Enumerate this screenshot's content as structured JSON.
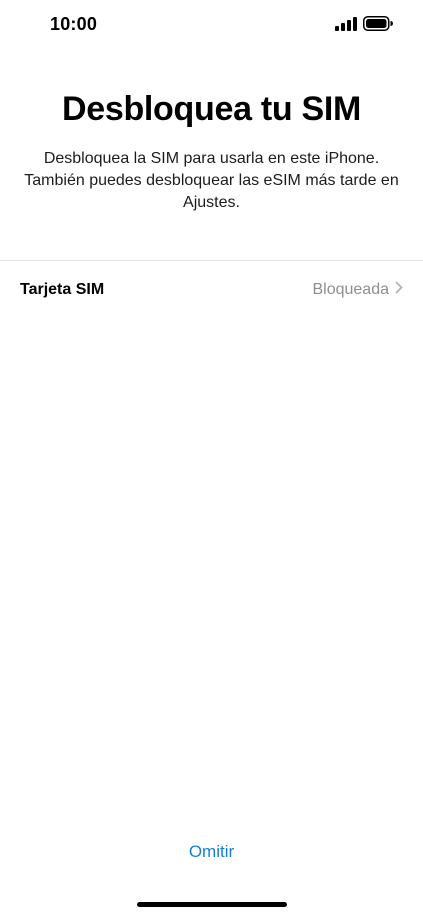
{
  "status_bar": {
    "time": "10:00",
    "signal_icon": "cellular-signal-icon",
    "battery_icon": "battery-full-icon"
  },
  "header": {
    "title": "Desbloquea tu SIM",
    "subtitle": "Desbloquea la SIM para usarla en este iPhone. También puedes desbloquear las eSIM más tarde en Ajustes."
  },
  "sim_list": {
    "items": [
      {
        "label": "Tarjeta SIM",
        "status": "Bloqueada",
        "icon": "chevron-right-icon"
      }
    ]
  },
  "footer": {
    "skip_label": "Omitir"
  },
  "colors": {
    "accent": "#147fd6",
    "secondary_text": "#8e8e93",
    "divider": "#e5e5ea"
  }
}
